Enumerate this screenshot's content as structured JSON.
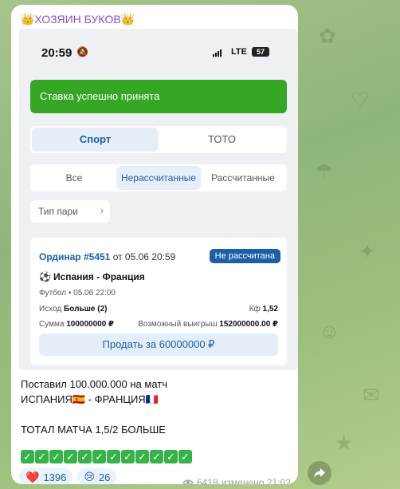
{
  "channel": {
    "name": "👑ХОЗЯИН БУКОВ👑"
  },
  "screenshot": {
    "status_bar": {
      "time": "20:59",
      "network": "LTE",
      "battery": "57"
    },
    "toast": "Ставка успешно принята",
    "main_tabs": [
      "Спорт",
      "ТОТО"
    ],
    "bet_tabs": [
      "Все",
      "Нерассчитанные",
      "Рассчитанные"
    ],
    "filter_label": "Тип пари",
    "bet": {
      "type": "Ординар",
      "number": "#5451",
      "date_text": "от 05.06 20:59",
      "status": "Не рассчитана",
      "match": "Испания - Франция",
      "sport_line": "Футбол • 05.06 22:00",
      "outcome_label": "Исход",
      "outcome_value": "Больше (2)",
      "coef_label": "Кф",
      "coef_value": "1,52",
      "stake_label": "Сумма",
      "stake_value": "100000000 ₽",
      "win_label": "Возможный выигрыш",
      "win_value": "152000000.00 ₽",
      "sell_button": "Продать за 60000000 ₽"
    }
  },
  "message": {
    "line1": "Поставил 100.000.000 на матч",
    "line2": "ИСПАНИЯ🇪🇸 - ФРАНЦИЯ🇫🇷",
    "line3": "ТОТАЛ МАТЧА 1,5/2 БОЛЬШЕ",
    "check_count": 12
  },
  "reactions": [
    {
      "emoji": "❤️",
      "count": "1396"
    },
    {
      "emoji": "😢",
      "count": "26"
    }
  ],
  "footer": {
    "views": "6418",
    "edited_time": "изменено 21:02"
  }
}
